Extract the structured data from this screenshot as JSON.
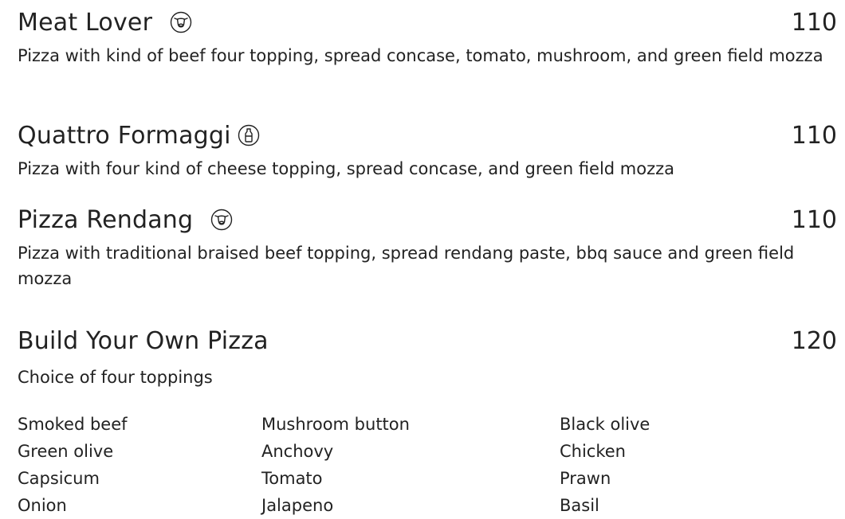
{
  "items": [
    {
      "name": "Meat Lover",
      "icon": "cow-head-icon",
      "price": "110",
      "description": "Pizza with kind of beef four topping, spread concase, tomato, mushroom, and green field mozza"
    },
    {
      "name": "Quattro Formaggi",
      "icon": "milk-bottle-icon",
      "price": "110",
      "description": "Pizza with four kind of cheese topping, spread concase, and green field mozza"
    },
    {
      "name": "Pizza Rendang",
      "icon": "cow-head-icon",
      "price": "110",
      "description": "Pizza with traditional braised beef topping, spread rendang paste, bbq sauce and green field mozza"
    },
    {
      "name": "Build Your Own Pizza",
      "price": "120",
      "description": "Choice of four toppings"
    }
  ],
  "toppings": {
    "columns": [
      [
        "Smoked beef",
        "Green olive",
        "Capsicum",
        "Onion"
      ],
      [
        "Mushroom button",
        "Anchovy",
        "Tomato",
        "Jalapeno"
      ],
      [
        "Black olive",
        "Chicken",
        "Prawn",
        "Basil"
      ]
    ]
  },
  "colors": {
    "text": "#222222",
    "background": "#ffffff"
  }
}
